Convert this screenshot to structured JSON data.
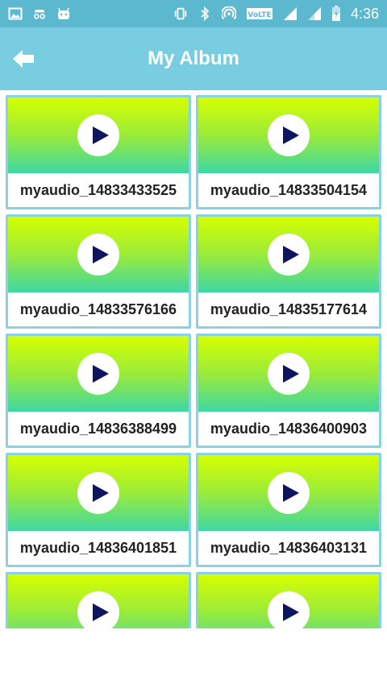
{
  "status_bar": {
    "time": "4:36",
    "left_icons": [
      "image-icon",
      "incognito-icon",
      "android-icon"
    ],
    "right_icons": [
      "vibrate-icon",
      "bluetooth-icon",
      "hotspot-icon",
      "volte-icon",
      "signal-icon",
      "signal-icon",
      "battery-icon"
    ],
    "volte_label": "VoLTE"
  },
  "app_bar": {
    "title": "My Album",
    "back_icon": "back-arrow-icon"
  },
  "album": {
    "items": [
      {
        "label": "myaudio_14833433525"
      },
      {
        "label": "myaudio_14833504154"
      },
      {
        "label": "myaudio_14833576166"
      },
      {
        "label": "myaudio_14835177614"
      },
      {
        "label": "myaudio_14836388499"
      },
      {
        "label": "myaudio_14836400903"
      },
      {
        "label": "myaudio_14836401851"
      },
      {
        "label": "myaudio_14836403131"
      },
      {
        "label": ""
      },
      {
        "label": ""
      }
    ]
  },
  "colors": {
    "status_bar": "#5cb8cf",
    "app_bar": "#79cde0",
    "card_border": "#89d2e1",
    "play_icon": "#0d1560",
    "gradient_top": "#d6ff00",
    "gradient_bottom": "#3ed7a4"
  }
}
